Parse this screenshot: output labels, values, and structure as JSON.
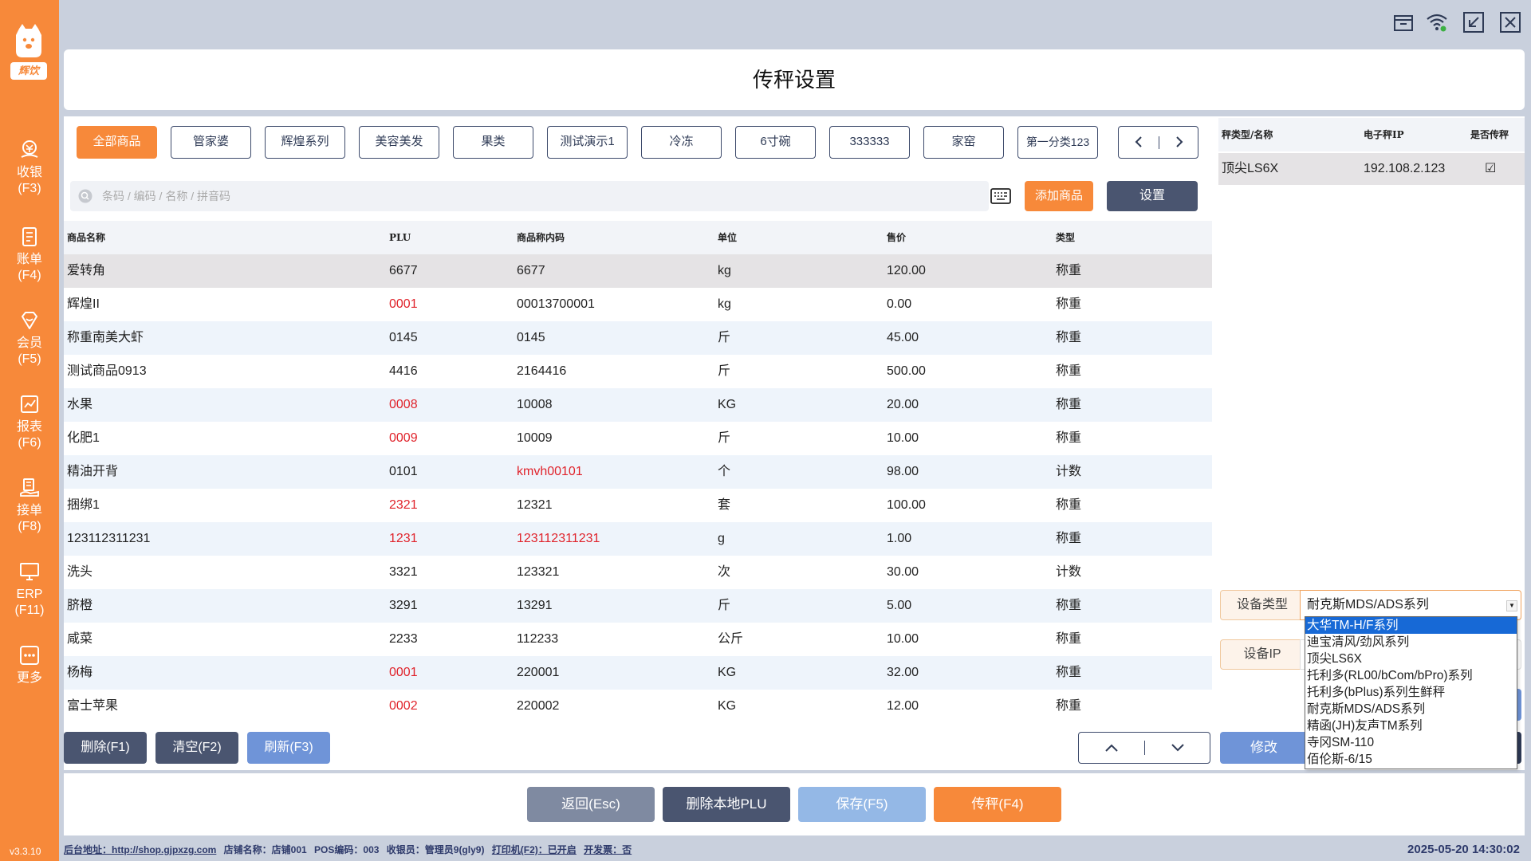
{
  "app": {
    "brand": "辉饮",
    "version": "v3.3.10",
    "title": "传秤设置"
  },
  "sidebar": {
    "items": [
      {
        "label": "收银",
        "key": "(F3)",
        "icon": "cashier-icon"
      },
      {
        "label": "账单",
        "key": "(F4)",
        "icon": "bill-icon"
      },
      {
        "label": "会员",
        "key": "(F5)",
        "icon": "member-icon"
      },
      {
        "label": "报表",
        "key": "(F6)",
        "icon": "report-icon"
      },
      {
        "label": "接单",
        "key": "(F8)",
        "icon": "order-icon"
      },
      {
        "label": "ERP",
        "key": "(F11)",
        "icon": "erp-icon"
      },
      {
        "label": "更多",
        "key": "",
        "icon": "more-icon"
      }
    ]
  },
  "categories": [
    "全部商品",
    "管家婆",
    "辉煌系列",
    "美容美发",
    "果类",
    "测试演示1",
    "冷冻",
    "6寸碗",
    "333333",
    "家窑",
    "第一分类123"
  ],
  "search": {
    "placeholder": "条码 / 编码 / 名称 / 拼音码",
    "add_label": "添加商品",
    "settings_label": "设置"
  },
  "table": {
    "headers": [
      "商品名称",
      "PLU",
      "商品称内码",
      "单位",
      "售价",
      "类型"
    ],
    "rows": [
      {
        "name": "爱转角",
        "plu": "6677",
        "code": "6677",
        "unit": "kg",
        "price": "120.00",
        "type": "称重",
        "plu_red": false,
        "code_red": false
      },
      {
        "name": "辉煌II",
        "plu": "0001",
        "code": "00013700001",
        "unit": "kg",
        "price": "0.00",
        "type": "称重",
        "plu_red": true,
        "code_red": false
      },
      {
        "name": "称重南美大虾",
        "plu": "0145",
        "code": "0145",
        "unit": "斤",
        "price": "45.00",
        "type": "称重",
        "plu_red": false,
        "code_red": false
      },
      {
        "name": "测试商品0913",
        "plu": "4416",
        "code": "2164416",
        "unit": "斤",
        "price": "500.00",
        "type": "称重",
        "plu_red": false,
        "code_red": false
      },
      {
        "name": "水果",
        "plu": "0008",
        "code": "10008",
        "unit": "KG",
        "price": "20.00",
        "type": "称重",
        "plu_red": true,
        "code_red": false
      },
      {
        "name": "化肥1",
        "plu": "0009",
        "code": "10009",
        "unit": "斤",
        "price": "10.00",
        "type": "称重",
        "plu_red": true,
        "code_red": false
      },
      {
        "name": "精油开背",
        "plu": "0101",
        "code": "kmvh00101",
        "unit": "个",
        "price": "98.00",
        "type": "计数",
        "plu_red": false,
        "code_red": true
      },
      {
        "name": "捆绑1",
        "plu": "2321",
        "code": "12321",
        "unit": "套",
        "price": "100.00",
        "type": "称重",
        "plu_red": true,
        "code_red": false
      },
      {
        "name": "123112311231",
        "plu": "1231",
        "code": "123112311231",
        "unit": "g",
        "price": "1.00",
        "type": "称重",
        "plu_red": true,
        "code_red": true
      },
      {
        "name": "洗头",
        "plu": "3321",
        "code": "123321",
        "unit": "次",
        "price": "30.00",
        "type": "计数",
        "plu_red": false,
        "code_red": false
      },
      {
        "name": "脐橙",
        "plu": "3291",
        "code": "13291",
        "unit": "斤",
        "price": "5.00",
        "type": "称重",
        "plu_red": false,
        "code_red": false
      },
      {
        "name": "咸菜",
        "plu": "2233",
        "code": "112233",
        "unit": "公斤",
        "price": "10.00",
        "type": "称重",
        "plu_red": false,
        "code_red": false
      },
      {
        "name": "杨梅",
        "plu": "0001",
        "code": "220001",
        "unit": "KG",
        "price": "32.00",
        "type": "称重",
        "plu_red": true,
        "code_red": false
      },
      {
        "name": "富士苹果",
        "plu": "0002",
        "code": "220002",
        "unit": "KG",
        "price": "12.00",
        "type": "称重",
        "plu_red": true,
        "code_red": false
      }
    ]
  },
  "left_buttons": {
    "delete": "删除(F1)",
    "clear": "清空(F2)",
    "refresh": "刷新(F3)"
  },
  "scales": {
    "headers": [
      "秤类型/名称",
      "电子秤IP",
      "是否传秤"
    ],
    "rows": [
      {
        "name": "顶尖LS6X",
        "ip": "192.108.2.123",
        "checked": "☑"
      }
    ]
  },
  "device": {
    "type_label": "设备类型",
    "type_value": "耐克斯MDS/ADS系列",
    "ip_label": "设备IP",
    "edit_label": "修改",
    "options": [
      "大华TM-H/F系列",
      "迪宝清风/劲风系列",
      "顶尖LS6X",
      "托利多(RL00/bCom/bPro)系列",
      "托利多(bPlus)系列生鲜秤",
      "耐克斯MDS/ADS系列",
      "精函(JH)友声TM系列",
      "寺冈SM-110",
      "佰伦斯-6/15"
    ],
    "highlighted": "大华TM-H/F系列"
  },
  "actions": {
    "back": "返回(Esc)",
    "delete_plu": "删除本地PLU",
    "save": "保存(F5)",
    "send": "传秤(F4)"
  },
  "status": {
    "backend": "后台地址：http://shop.gjpxzg.com",
    "store": "店铺名称：店铺001",
    "pos": "POS编码：003",
    "cashier": "收银员：管理员9(gly9)",
    "printer": "打印机(F2)：已开启",
    "invoice": "开发票：否",
    "datetime": "2025-05-20 14:30:02"
  },
  "colors": {
    "accent": "#f7893a",
    "dark": "#4a5570",
    "blue": "#6f94d8",
    "red": "#e0232b"
  }
}
